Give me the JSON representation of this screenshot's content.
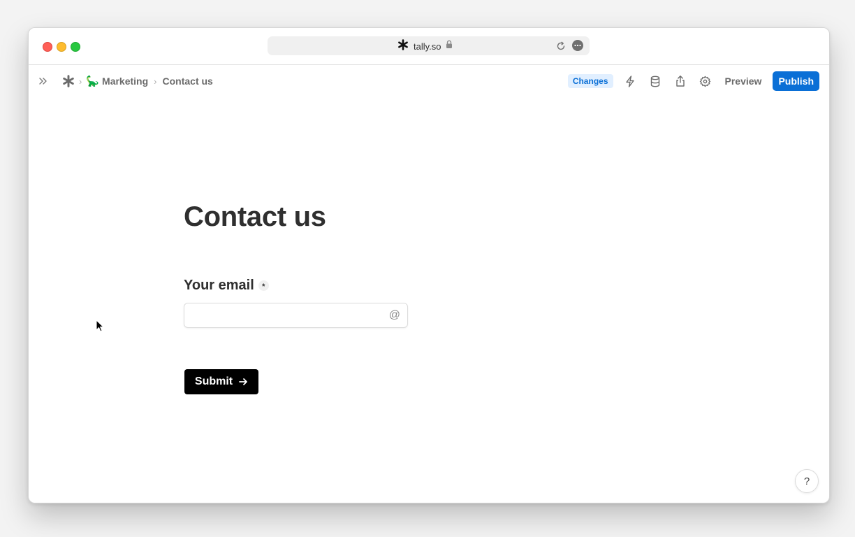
{
  "browser": {
    "url": "tally.so"
  },
  "breadcrumb": {
    "workspace_emoji": "🦕",
    "workspace": "Marketing",
    "page": "Contact us"
  },
  "toolbar": {
    "changes_label": "Changes",
    "preview_label": "Preview",
    "publish_label": "Publish",
    "icons": [
      "expand-sidebar-icon",
      "tally-logo-icon",
      "lightning-icon",
      "database-icon",
      "share-icon",
      "gear-icon"
    ]
  },
  "form": {
    "title": "Contact us",
    "question_label": "Your email",
    "required_mark": "*",
    "email_value": "",
    "email_icon": "@",
    "submit_label": "Submit"
  },
  "help": {
    "label": "?"
  },
  "colors": {
    "accent": "#0a6fd6",
    "changes_bg": "#e1efff",
    "submit_bg": "#000000"
  }
}
